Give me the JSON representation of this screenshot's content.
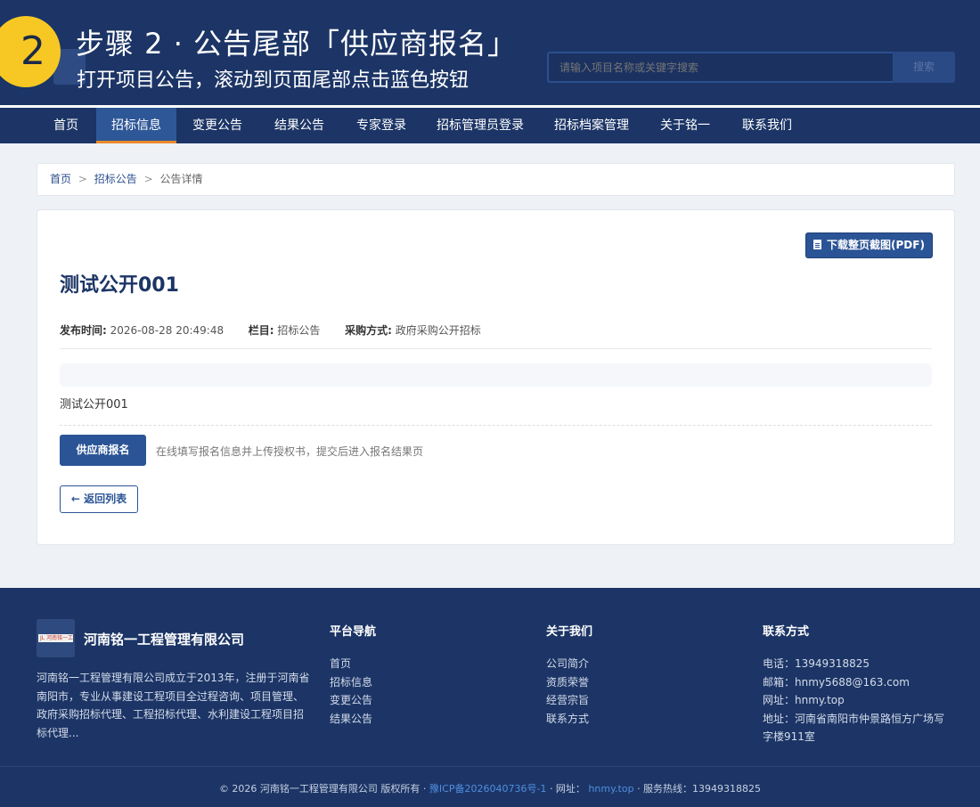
{
  "overlay": {
    "step_number": "2",
    "title": "步骤 2 · 公告尾部「供应商报名」",
    "subtitle": "打开项目公告，滚动到页面尾部点击蓝色按钮"
  },
  "header": {
    "search_placeholder": "请输入项目名称或关键字搜索",
    "search_button": "搜索"
  },
  "nav": {
    "items": [
      {
        "label": "首页"
      },
      {
        "label": "招标信息"
      },
      {
        "label": "变更公告"
      },
      {
        "label": "结果公告"
      },
      {
        "label": "专家登录"
      },
      {
        "label": "招标管理员登录"
      },
      {
        "label": "招标档案管理"
      },
      {
        "label": "关于铭一"
      },
      {
        "label": "联系我们"
      }
    ],
    "active_index": 1
  },
  "breadcrumb": {
    "home": "首页",
    "section": "招标公告",
    "current": "公告详情",
    "separator": ">"
  },
  "article": {
    "pdf_button": "下载整页截图(PDF)",
    "title": "测试公开001",
    "meta": {
      "publish_label": "发布时间:",
      "publish_value": "2026-08-28 20:49:48",
      "column_label": "栏目:",
      "column_value": "招标公告",
      "method_label": "采购方式:",
      "method_value": "政府采购公开招标"
    },
    "body": "测试公开001",
    "signup_button": "供应商报名",
    "signup_hint": "在线填写报名信息并上传授权书，提交后进入报名结果页",
    "back_button": "← 返回列表"
  },
  "footer": {
    "company": "河南铭一工程管理有限公司",
    "description": "河南铭一工程管理有限公司成立于2013年，注册于河南省南阳市，专业从事建设工程项目全过程咨询、项目管理、政府采购招标代理、工程招标代理、水利建设工程项目招标代理...",
    "nav_heading": "平台导航",
    "nav_items": [
      "首页",
      "招标信息",
      "变更公告",
      "结果公告"
    ],
    "about_heading": "关于我们",
    "about_items": [
      "公司简介",
      "资质荣誉",
      "经营宗旨",
      "联系方式"
    ],
    "contact_heading": "联系方式",
    "contact": {
      "phone": "电话：13949318825",
      "email": "邮箱：hnmy5688@163.com",
      "website": "网址：hnmy.top",
      "address": "地址：河南省南阳市仲景路恒方广场写字楼911室"
    },
    "copyright_prefix": "© 2026 河南铭一工程管理有限公司 版权所有 ·",
    "icp": "豫ICP备2026040736号-1",
    "site_label": "· 网址：",
    "site": "hnmy.top",
    "hotline": "· 服务热线：13949318825"
  },
  "colors": {
    "brand_navy": "#1c3566",
    "primary_button": "#2b5496",
    "active_tab_underline": "#e88a2c",
    "step_badge": "#f7c823"
  }
}
